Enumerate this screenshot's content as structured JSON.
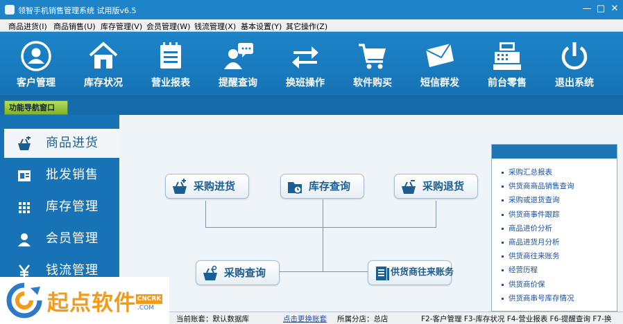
{
  "window": {
    "title": "领智手机销售管理系统 试用版v6.5",
    "minimize": "—",
    "maximize": "□",
    "close": "✕"
  },
  "menu": [
    "商品进货(I)",
    "商品销售(U)",
    "库存管理(V)",
    "会员管理(W)",
    "钱流管理(X)",
    "基本设置(Y)",
    "其它操作(Z)"
  ],
  "toolbar": [
    {
      "label": "客户管理",
      "icon": "user-circle-icon"
    },
    {
      "label": "库存状况",
      "icon": "house-icon"
    },
    {
      "label": "营业报表",
      "icon": "notepad-icon"
    },
    {
      "label": "提醒查询",
      "icon": "chat-user-icon"
    },
    {
      "label": "换班操作",
      "icon": "swap-arrows-icon"
    },
    {
      "label": "软件购买",
      "icon": "shopping-cart-icon"
    },
    {
      "label": "短信群发",
      "icon": "envelope-icon"
    },
    {
      "label": "前台零售",
      "icon": "cash-register-icon"
    },
    {
      "label": "退出系统",
      "icon": "power-icon"
    }
  ],
  "nav_tab": "功能导航窗口",
  "sidebar": [
    {
      "label": "商品进货",
      "icon": "basket-plus-icon",
      "active": true
    },
    {
      "label": "批发销售",
      "icon": "invoice-icon",
      "active": false
    },
    {
      "label": "库存管理",
      "icon": "grid-icon",
      "active": false
    },
    {
      "label": "会员管理",
      "icon": "person-icon",
      "active": false
    },
    {
      "label": "钱流管理",
      "icon": "yen-icon",
      "active": false
    }
  ],
  "flow": {
    "purchase": "采购进货",
    "stock_query": "库存查询",
    "purchase_return": "采购退货",
    "purchase_query": "采购查询",
    "supplier_account": "供货商往来账务"
  },
  "reports": [
    "采购汇总报表",
    "供货商商品销售查询",
    "采购或退货查询",
    "供货商事件跟踪",
    "商品进价分析",
    "商品进货月分析",
    "供货商往来账务",
    "经营历程",
    "供货商价保",
    "供货商串号库存情况"
  ],
  "status": {
    "account_label": "当前账套：默认数据库",
    "switch_link": "点击更换账套",
    "branch": "所属分店：总店",
    "shortcuts": "F2-客户管理  F3-库存状况  F4-营业报表  F6-提醒查询  F7-换"
  },
  "watermark": {
    "brand": "起点软件",
    "badge": "CNCRK",
    "domain": ".COM"
  },
  "colors": {
    "primary": "#1a7bbf",
    "active_text": "#1b5e91",
    "link": "#1850b8",
    "brand_orange": "#f39a1a"
  }
}
